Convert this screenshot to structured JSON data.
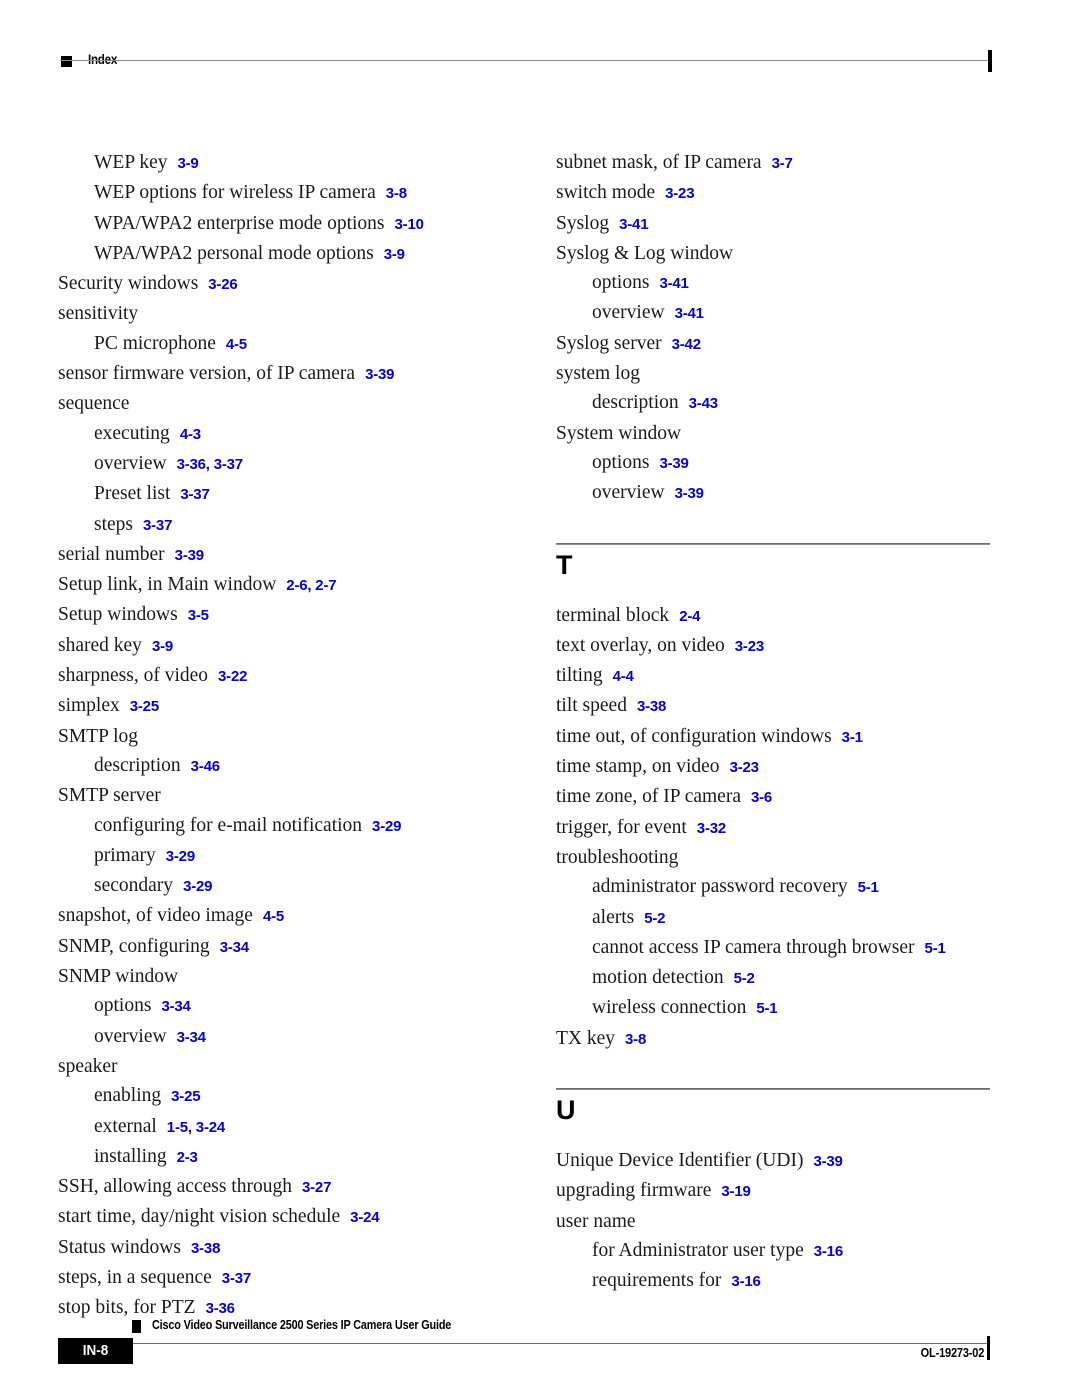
{
  "header": {
    "title": "Index",
    "marker_icon": "filled-square-icon"
  },
  "columns": [
    {
      "id": "left",
      "blocks": [
        {
          "type": "entries",
          "entries": [
            {
              "level": 1,
              "term": "WEP key",
              "refs": "3-9"
            },
            {
              "level": 1,
              "term": "WEP options for wireless IP camera",
              "refs": "3-8"
            },
            {
              "level": 1,
              "term": "WPA/WPA2 enterprise mode options",
              "refs": "3-10"
            },
            {
              "level": 1,
              "term": "WPA/WPA2 personal mode options",
              "refs": "3-9"
            },
            {
              "level": 0,
              "term": "Security windows",
              "refs": "3-26"
            },
            {
              "level": 0,
              "term": "sensitivity",
              "refs": ""
            },
            {
              "level": 1,
              "term": "PC microphone",
              "refs": "4-5"
            },
            {
              "level": 0,
              "term": "sensor firmware version, of IP camera",
              "refs": "3-39"
            },
            {
              "level": 0,
              "term": "sequence",
              "refs": ""
            },
            {
              "level": 1,
              "term": "executing",
              "refs": "4-3"
            },
            {
              "level": 1,
              "term": "overview",
              "refs": "3-36, 3-37"
            },
            {
              "level": 1,
              "term": "Preset list",
              "refs": "3-37"
            },
            {
              "level": 1,
              "term": "steps",
              "refs": "3-37"
            },
            {
              "level": 0,
              "term": "serial number",
              "refs": "3-39"
            },
            {
              "level": 0,
              "term": "Setup link, in Main window",
              "refs": "2-6, 2-7"
            },
            {
              "level": 0,
              "term": "Setup windows",
              "refs": "3-5"
            },
            {
              "level": 0,
              "term": "shared key",
              "refs": "3-9"
            },
            {
              "level": 0,
              "term": "sharpness, of video",
              "refs": "3-22"
            },
            {
              "level": 0,
              "term": "simplex",
              "refs": "3-25"
            },
            {
              "level": 0,
              "term": "SMTP log",
              "refs": ""
            },
            {
              "level": 1,
              "term": "description",
              "refs": "3-46"
            },
            {
              "level": 0,
              "term": "SMTP server",
              "refs": ""
            },
            {
              "level": 1,
              "term": "configuring for e-mail notification",
              "refs": "3-29"
            },
            {
              "level": 1,
              "term": "primary",
              "refs": "3-29"
            },
            {
              "level": 1,
              "term": "secondary",
              "refs": "3-29"
            },
            {
              "level": 0,
              "term": "snapshot, of video image",
              "refs": "4-5"
            },
            {
              "level": 0,
              "term": "SNMP, configuring",
              "refs": "3-34"
            },
            {
              "level": 0,
              "term": "SNMP window",
              "refs": ""
            },
            {
              "level": 1,
              "term": "options",
              "refs": "3-34"
            },
            {
              "level": 1,
              "term": "overview",
              "refs": "3-34"
            },
            {
              "level": 0,
              "term": "speaker",
              "refs": ""
            },
            {
              "level": 1,
              "term": "enabling",
              "refs": "3-25"
            },
            {
              "level": 1,
              "term": "external",
              "refs": "1-5, 3-24"
            },
            {
              "level": 1,
              "term": "installing",
              "refs": "2-3"
            },
            {
              "level": 0,
              "term": "SSH, allowing access through",
              "refs": "3-27"
            },
            {
              "level": 0,
              "term": "start time, day/night vision schedule",
              "refs": "3-24"
            },
            {
              "level": 0,
              "term": "Status windows",
              "refs": "3-38"
            },
            {
              "level": 0,
              "term": "steps, in a sequence",
              "refs": "3-37"
            },
            {
              "level": 0,
              "term": "stop bits, for PTZ",
              "refs": "3-36"
            }
          ]
        }
      ]
    },
    {
      "id": "right",
      "blocks": [
        {
          "type": "entries",
          "entries": [
            {
              "level": 0,
              "term": "subnet mask, of IP camera",
              "refs": "3-7"
            },
            {
              "level": 0,
              "term": "switch mode",
              "refs": "3-23"
            },
            {
              "level": 0,
              "term": "Syslog",
              "refs": "3-41"
            },
            {
              "level": 0,
              "term": "Syslog & Log window",
              "refs": ""
            },
            {
              "level": 1,
              "term": "options",
              "refs": "3-41"
            },
            {
              "level": 1,
              "term": "overview",
              "refs": "3-41"
            },
            {
              "level": 0,
              "term": "Syslog server",
              "refs": "3-42"
            },
            {
              "level": 0,
              "term": "system log",
              "refs": ""
            },
            {
              "level": 1,
              "term": "description",
              "refs": "3-43"
            },
            {
              "level": 0,
              "term": "System window",
              "refs": ""
            },
            {
              "level": 1,
              "term": "options",
              "refs": "3-39"
            },
            {
              "level": 1,
              "term": "overview",
              "refs": "3-39"
            }
          ]
        },
        {
          "type": "section",
          "letter": "T"
        },
        {
          "type": "entries",
          "entries": [
            {
              "level": 0,
              "term": "terminal block",
              "refs": "2-4"
            },
            {
              "level": 0,
              "term": "text overlay, on video",
              "refs": "3-23"
            },
            {
              "level": 0,
              "term": "tilting",
              "refs": "4-4"
            },
            {
              "level": 0,
              "term": "tilt speed",
              "refs": "3-38"
            },
            {
              "level": 0,
              "term": "time out, of configuration windows",
              "refs": "3-1"
            },
            {
              "level": 0,
              "term": "time stamp, on video",
              "refs": "3-23"
            },
            {
              "level": 0,
              "term": "time zone, of IP camera",
              "refs": "3-6"
            },
            {
              "level": 0,
              "term": "trigger, for event",
              "refs": "3-32"
            },
            {
              "level": 0,
              "term": "troubleshooting",
              "refs": ""
            },
            {
              "level": 1,
              "term": "administrator password recovery",
              "refs": "5-1"
            },
            {
              "level": 1,
              "term": "alerts",
              "refs": "5-2"
            },
            {
              "level": 1,
              "term": "cannot access IP camera through browser",
              "refs": "5-1"
            },
            {
              "level": 1,
              "term": "motion detection",
              "refs": "5-2"
            },
            {
              "level": 1,
              "term": "wireless connection",
              "refs": "5-1"
            },
            {
              "level": 0,
              "term": "TX key",
              "refs": "3-8"
            }
          ]
        },
        {
          "type": "section",
          "letter": "U"
        },
        {
          "type": "entries",
          "entries": [
            {
              "level": 0,
              "term": "Unique Device Identifier (UDI)",
              "refs": "3-39"
            },
            {
              "level": 0,
              "term": "upgrading firmware",
              "refs": "3-19"
            },
            {
              "level": 0,
              "term": "user name",
              "refs": ""
            },
            {
              "level": 1,
              "term": "for Administrator user type",
              "refs": "3-16"
            },
            {
              "level": 1,
              "term": "requirements for",
              "refs": "3-16"
            }
          ]
        }
      ]
    }
  ],
  "footer": {
    "page_number": "IN-8",
    "guide_title": "Cisco Video Surveillance 2500 Series IP Camera User Guide",
    "doc_id": "OL-19273-02",
    "marker_icon": "filled-square-icon"
  }
}
